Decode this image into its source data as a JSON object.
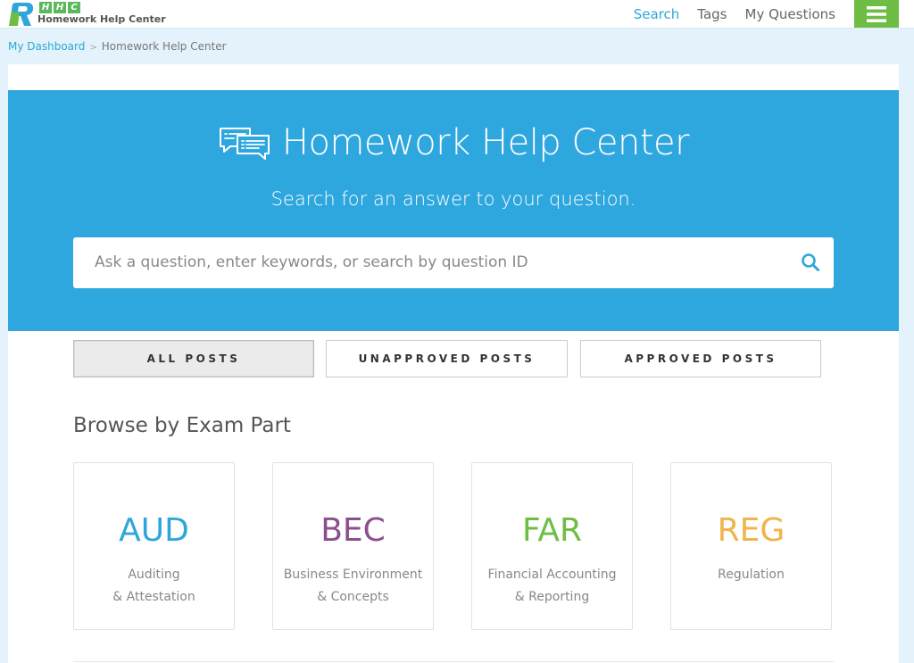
{
  "colors": {
    "accent": "#2ea7de",
    "link": "#2ea7d8",
    "menu_green": "#6ebd45",
    "aud": "#2ea7d8",
    "bec": "#8b4f8d",
    "far": "#6ebd45",
    "reg": "#f0b44c"
  },
  "logo": {
    "abbr": [
      "H",
      "H",
      "C"
    ],
    "name": "Homework Help Center"
  },
  "nav": {
    "items": [
      {
        "label": "Search",
        "active": true
      },
      {
        "label": "Tags",
        "active": false
      },
      {
        "label": "My Questions",
        "active": false
      }
    ],
    "menu_icon": "hamburger-icon"
  },
  "breadcrumb": {
    "home": "My Dashboard",
    "separator": ">",
    "current": "Homework Help Center"
  },
  "hero": {
    "icon": "chat-bubbles-icon",
    "title": "Homework Help Center",
    "subtitle": "Search for an answer to your question.",
    "search_placeholder": "Ask a question, enter keywords, or search by question ID",
    "search_value": "",
    "search_icon": "search-icon"
  },
  "filters": [
    {
      "label": "ALL POSTS",
      "active": true
    },
    {
      "label": "UNAPPROVED POSTS",
      "active": false
    },
    {
      "label": "APPROVED POSTS",
      "active": false
    }
  ],
  "browse": {
    "title": "Browse by Exam Part",
    "cards": [
      {
        "code": "AUD",
        "line1": "Auditing",
        "line2": "& Attestation"
      },
      {
        "code": "BEC",
        "line1": "Business Environment",
        "line2": "& Concepts"
      },
      {
        "code": "FAR",
        "line1": "Financial Accounting",
        "line2": "& Reporting"
      },
      {
        "code": "REG",
        "line1": "Regulation",
        "line2": ""
      }
    ]
  }
}
